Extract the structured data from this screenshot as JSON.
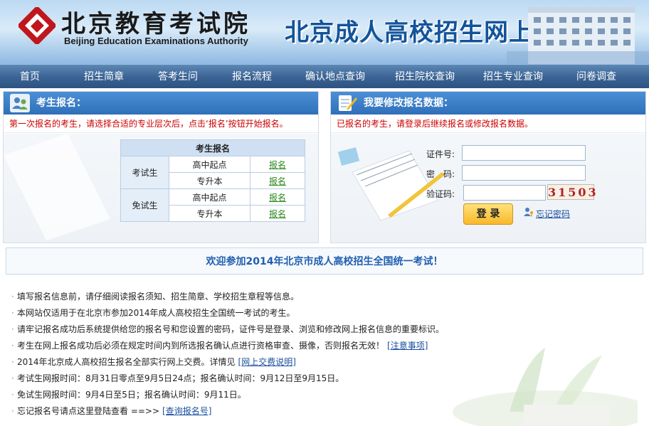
{
  "header": {
    "logo_cn": "北京教育考试院",
    "logo_en": "Beijing Education Examinations Authority",
    "title": "北京成人高校招生网上报名"
  },
  "nav": {
    "items": [
      "首页",
      "招生简章",
      "答考生问",
      "报名流程",
      "确认地点查询",
      "招生院校查询",
      "招生专业查询",
      "问卷调查"
    ]
  },
  "register_panel": {
    "title": "考生报名：",
    "note": "第一次报名的考生，请选择合适的专业层次后，点击‘报名’按钮开始报名。",
    "table_header": "考生报名",
    "groups": [
      {
        "label": "考试生",
        "rows": [
          {
            "level": "高中起点",
            "link": "报名"
          },
          {
            "level": "专升本",
            "link": "报名"
          }
        ]
      },
      {
        "label": "免试生",
        "rows": [
          {
            "level": "高中起点",
            "link": "报名"
          },
          {
            "level": "专升本",
            "link": "报名"
          }
        ]
      }
    ]
  },
  "login_panel": {
    "title": "我要修改报名数据：",
    "note": "已报名的考生，请登录后继续报名或修改报名数据。",
    "id_label": "证件号:",
    "password_label": "密　码:",
    "captcha_label": "验证码:",
    "id_value": "",
    "password_value": "",
    "captcha_value": "",
    "captcha_code": "31503",
    "login_label": "登 录",
    "forgot_label": "忘记密码"
  },
  "welcome": "欢迎参加2014年北京市成人高校招生全国统一考试！",
  "notes": [
    {
      "text": "填写报名信息前，请仔细阅读报名须知、招生简章、学校招生章程等信息。",
      "link": ""
    },
    {
      "text": "本网站仅适用于在北京市参加2014年成人高校招生全国统一考试的考生。",
      "link": ""
    },
    {
      "text": "请牢记报名成功后系统提供给您的报名号和您设置的密码，证件号是登录、浏览和修改网上报名信息的重要标识。",
      "link": ""
    },
    {
      "text": "考生在网上报名成功后必须在规定时间内到所选报名确认点进行资格审查、摄像，否则报名无效！",
      "link": "[注意事项]"
    },
    {
      "text": "2014年北京成人高校招生报名全部实行网上交费。详情见",
      "link": "[网上交费说明]"
    },
    {
      "text": "考试生网报时间：8月31日零点至9月5日24点；报名确认时间：9月12日至9月15日。",
      "link": ""
    },
    {
      "text": "免试生网报时间：9月4日至5日；报名确认时间：9月11日。",
      "link": ""
    },
    {
      "text": "忘记报名号请点这里登陆查看 ==>>",
      "link": "[查询报名号]"
    }
  ],
  "colors": {
    "nav_bg": "#3a6394",
    "panel_head": "#2f70b9",
    "warning": "#cc0000",
    "link_green": "#2b8a1e",
    "welcome_text": "#1f5fb0"
  }
}
